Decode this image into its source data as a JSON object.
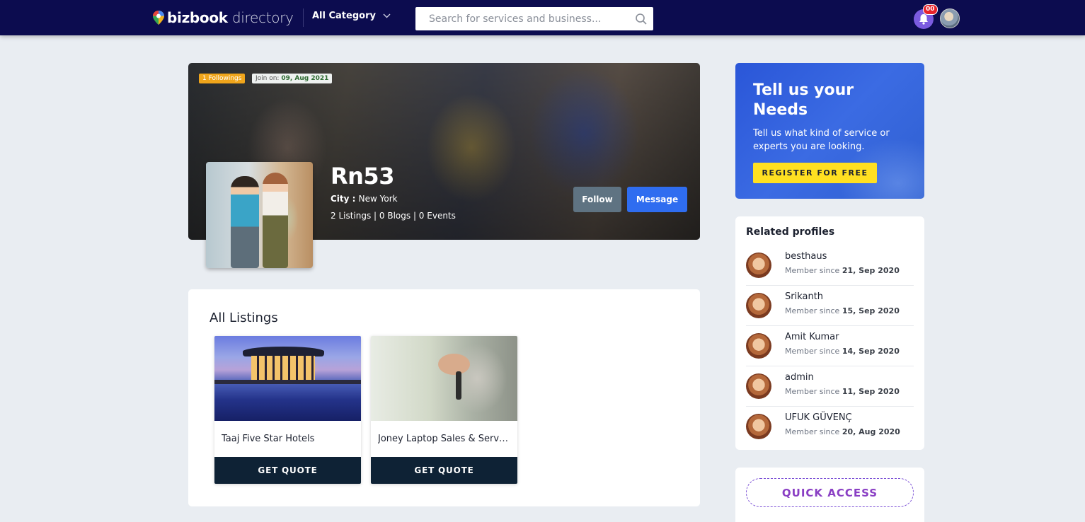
{
  "header": {
    "logo_bold": "bizbook",
    "logo_light": " directory",
    "category_label": "All Category",
    "search_placeholder": "Search for services and business...",
    "notification_count": "00"
  },
  "profile": {
    "followings": "1 Followings",
    "join_label": "Join on: ",
    "join_date": "09, Aug 2021",
    "name": "Rn53",
    "city_label": "City : ",
    "city": "New York",
    "stats": "2 Listings | 0 Blogs | 0 Events",
    "follow_label": "Follow",
    "message_label": "Message"
  },
  "listings": {
    "title": "All Listings",
    "items": [
      {
        "title": "Taaj Five Star Hotels",
        "button": "GET QUOTE"
      },
      {
        "title": "Joney Laptop Sales & Service",
        "button": "GET QUOTE"
      }
    ]
  },
  "promo": {
    "title": "Tell us your Needs",
    "description": "Tell us what kind of service or experts you are looking.",
    "button": "REGISTER FOR FREE"
  },
  "related": {
    "title": "Related profiles",
    "since_label": "Member since ",
    "items": [
      {
        "name": "besthaus",
        "date": "21, Sep 2020"
      },
      {
        "name": "Srikanth",
        "date": "15, Sep 2020"
      },
      {
        "name": "Amit Kumar",
        "date": "14, Sep 2020"
      },
      {
        "name": "admin",
        "date": "11, Sep 2020"
      },
      {
        "name": "UFUK GÜVENÇ",
        "date": "20, Aug 2020"
      }
    ]
  },
  "quick_access": {
    "label": "QUICK ACCESS"
  },
  "colors": {
    "header_bg": "#0c0c4f",
    "primary_blue": "#2f6df0",
    "accent_yellow": "#ffe021",
    "dark_button": "#0e2235"
  }
}
